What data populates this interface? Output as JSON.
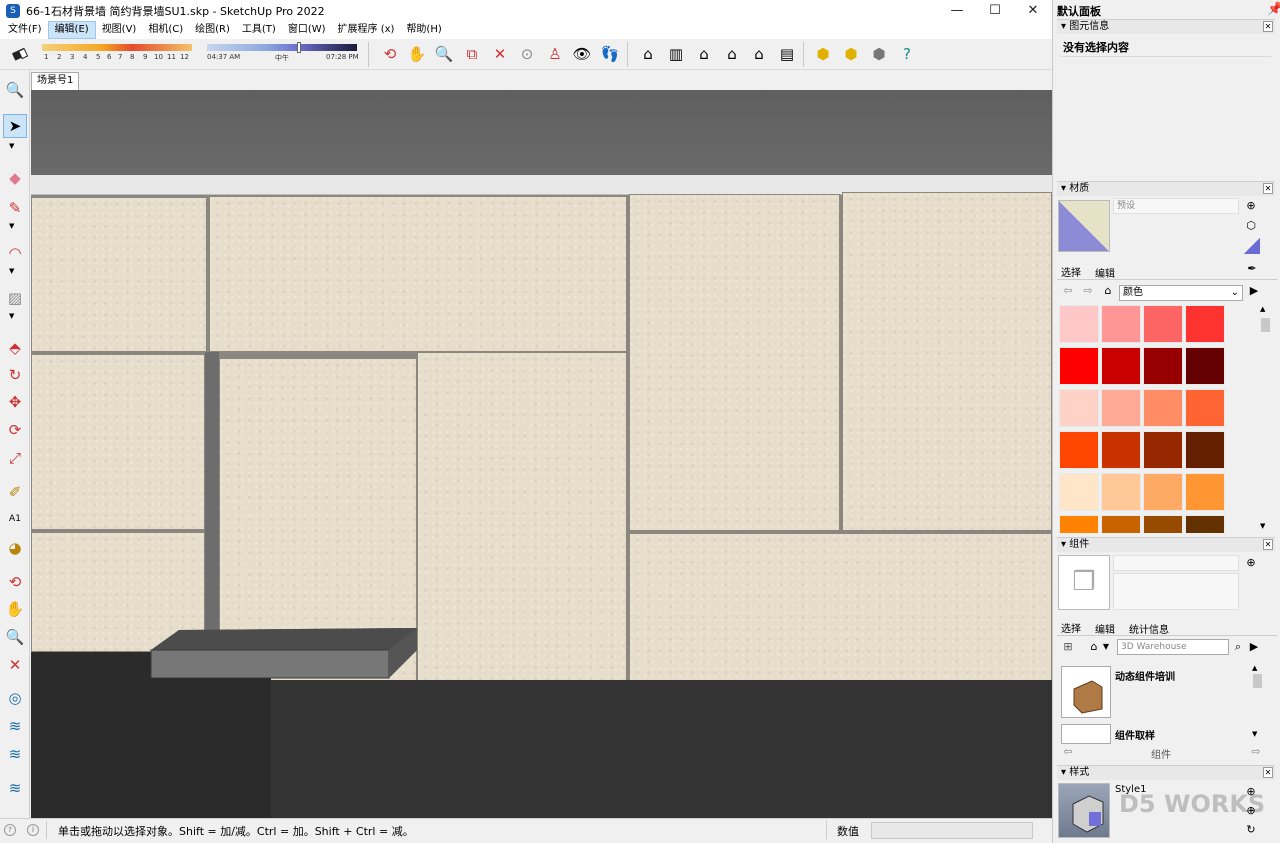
{
  "window": {
    "title": "66-1石材背景墙 简约背景墙SU1.skp - SketchUp Pro 2022",
    "minimize": "—",
    "maximize": "☐",
    "close": "✕"
  },
  "menu": [
    "文件(F)",
    "编辑(E)",
    "视图(V)",
    "相机(C)",
    "绘图(R)",
    "工具(T)",
    "窗口(W)",
    "扩展程序 (x)",
    "帮助(H)"
  ],
  "shadow": {
    "months": [
      "1",
      "2",
      "3",
      "4",
      "5",
      "6",
      "7",
      "8",
      "9",
      "10",
      "11",
      "12"
    ],
    "time_start": "04:37 AM",
    "time_mid": "中午",
    "time_end": "07:28 PM"
  },
  "scene": {
    "tab": "场景号1"
  },
  "status": {
    "message": "单击或拖动以选择对象。Shift = 加/减。Ctrl = 加。Shift + Ctrl = 减。",
    "measure_label": "数值",
    "measure_value": ""
  },
  "tray": {
    "title": "默认面板",
    "entity_info": {
      "header": "图元信息",
      "message": "没有选择内容"
    },
    "materials": {
      "header": "材质",
      "name_placeholder": "预设",
      "tab_select": "选择",
      "tab_edit": "编辑",
      "library": "颜色",
      "swatch_colors": [
        "#ffc8c8",
        "#ff9696",
        "#ff6464",
        "#ff3232",
        "#ff0000",
        "#c80000",
        "#960000",
        "#640000",
        "#ffd2c8",
        "#ffaa96",
        "#ff8c64",
        "#ff6432",
        "#ff4600",
        "#c83200",
        "#962800",
        "#641e00",
        "#ffe6c8",
        "#ffc896",
        "#ffaa64",
        "#ff9632",
        "#ff8200",
        "#c86400",
        "#964b00",
        "#643200"
      ]
    },
    "components": {
      "header": "组件",
      "tab_select": "选择",
      "tab_edit": "编辑",
      "tab_stats": "统计信息",
      "search_placeholder": "3D Warehouse",
      "items": [
        "动态组件培训",
        "组件取样"
      ],
      "footer": "组件"
    },
    "styles": {
      "header": "样式",
      "style_name": "Style1",
      "watermark": "D5 WORKS"
    }
  },
  "colors": {
    "selection_blue": "#cce4f7",
    "stone": "#e6ddca",
    "floor": "#2e2e2e",
    "ceiling": "#5e5e5e"
  }
}
